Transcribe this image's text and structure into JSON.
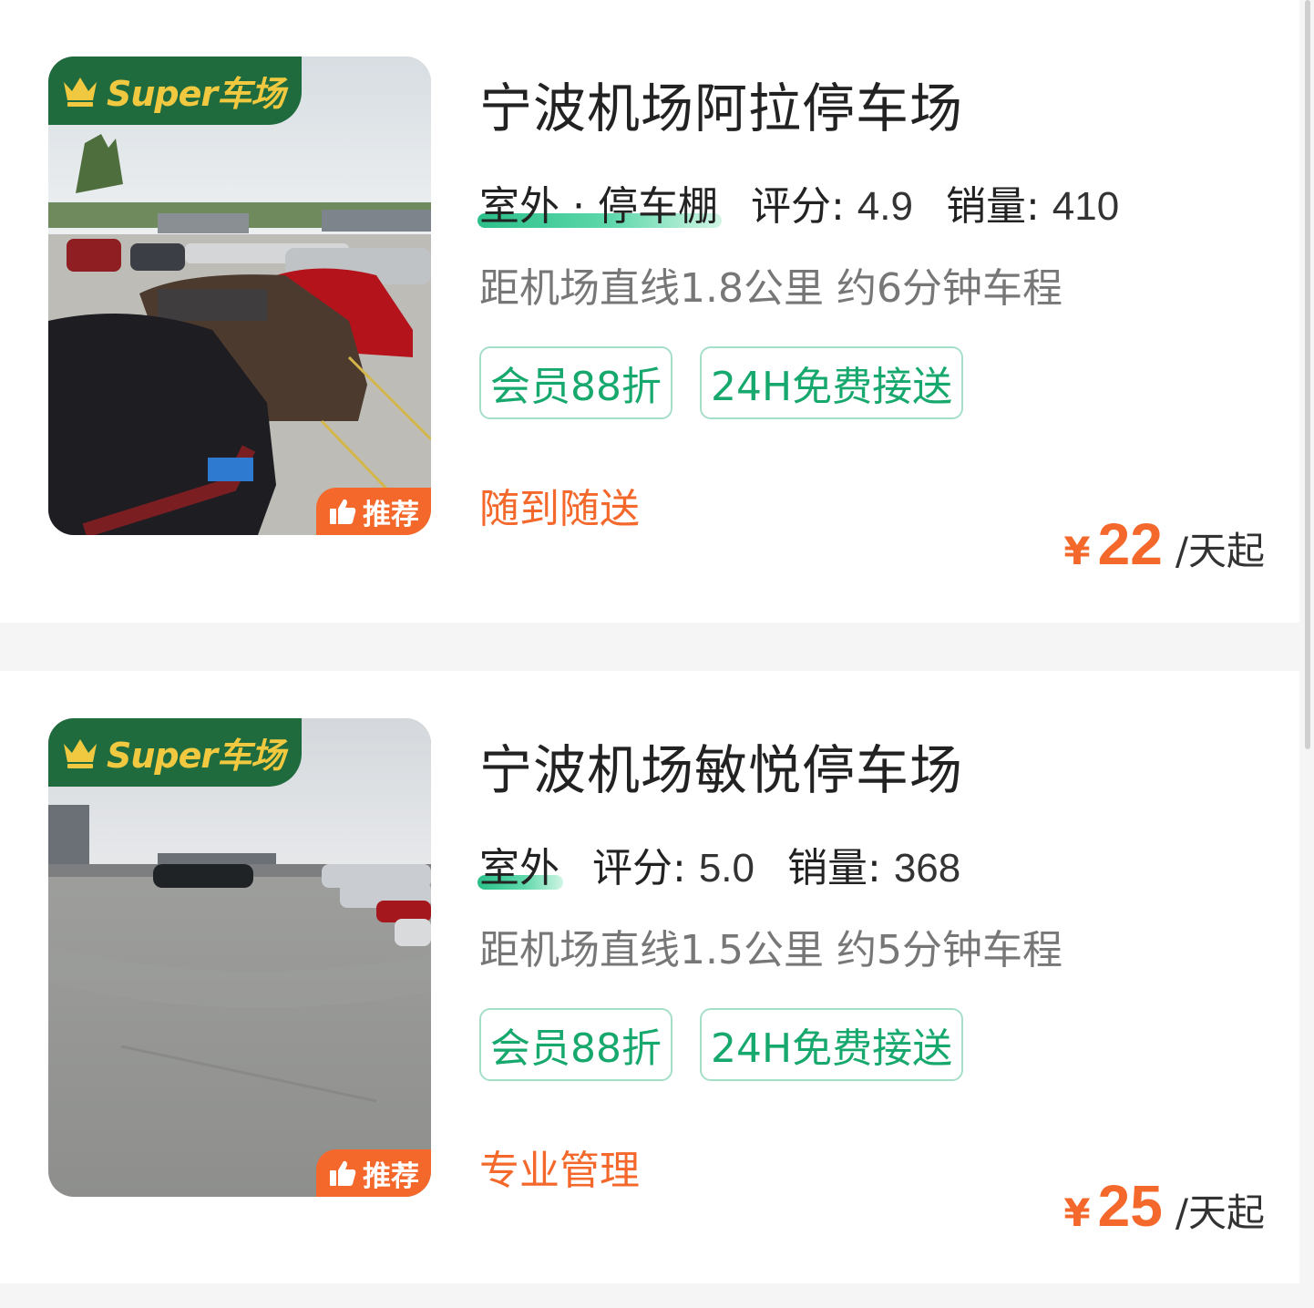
{
  "lots": [
    {
      "name": "宁波机场阿拉停车场",
      "super_badge": "Super车场",
      "recommend_badge": "推荐",
      "type": "室外 · 停车棚",
      "score_label": "评分:",
      "score": "4.9",
      "sales_label": "销量:",
      "sales": "410",
      "distance": "距机场直线1.8公里 约6分钟车程",
      "tags": [
        "会员88折",
        "24H免费接送"
      ],
      "feature": "随到随送",
      "currency": "¥",
      "price": "22",
      "price_unit": "/天起"
    },
    {
      "name": "宁波机场敏悦停车场",
      "super_badge": "Super车场",
      "recommend_badge": "推荐",
      "type": "室外",
      "score_label": "评分:",
      "score": "5.0",
      "sales_label": "销量:",
      "sales": "368",
      "distance": "距机场直线1.5公里 约5分钟车程",
      "tags": [
        "会员88折",
        "24H免费接送"
      ],
      "feature": "专业管理",
      "currency": "¥",
      "price": "25",
      "price_unit": "/天起"
    }
  ],
  "icons": {
    "crown": "crown-icon",
    "thumbs_up": "thumbs-up-icon"
  },
  "colors": {
    "accent_orange": "#f4682c",
    "accent_green": "#17a86e",
    "badge_green": "#1f6b3e",
    "badge_gold": "#f1c940"
  }
}
